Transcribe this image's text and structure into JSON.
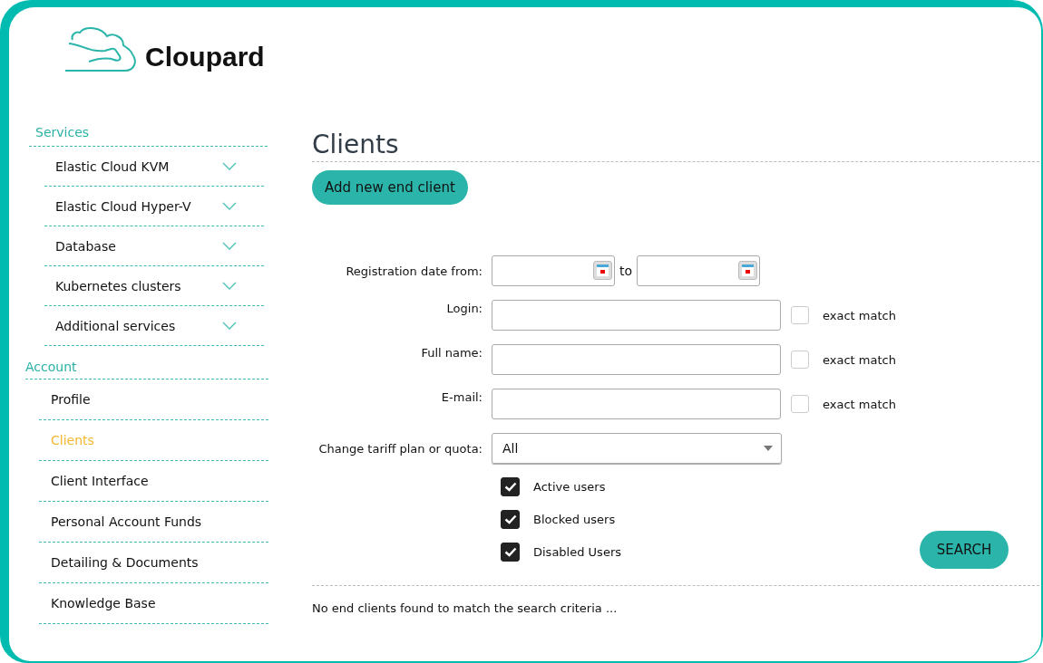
{
  "logo": {
    "text": "Cloupard"
  },
  "sidebar": {
    "sections": [
      {
        "title": "Services",
        "items": [
          {
            "label": "Elastic Cloud KVM",
            "kind": "dropdown",
            "selected": false
          },
          {
            "label": "Elastic Cloud Hyper-V",
            "kind": "dropdown",
            "selected": false
          },
          {
            "label": "Database",
            "kind": "dropdown",
            "selected": false
          },
          {
            "label": "Kubernetes clusters",
            "kind": "dropdown",
            "selected": false
          },
          {
            "label": "Additional services",
            "kind": "dropdown",
            "selected": false
          }
        ]
      },
      {
        "title": "Account",
        "items": [
          {
            "label": "Profile",
            "kind": "link",
            "selected": false
          },
          {
            "label": "Clients",
            "kind": "link",
            "selected": true
          },
          {
            "label": "Client Interface",
            "kind": "link",
            "selected": false
          },
          {
            "label": "Personal Account Funds",
            "kind": "link",
            "selected": false
          },
          {
            "label": "Detailing & Documents",
            "kind": "link",
            "selected": false
          },
          {
            "label": "Knowledge Base",
            "kind": "link",
            "selected": false
          }
        ]
      }
    ]
  },
  "page": {
    "title": "Clients",
    "add_button": "Add new end client"
  },
  "form": {
    "date": {
      "label": "Registration date from:",
      "separator": "to"
    },
    "text_fields": [
      {
        "label": "Login:",
        "exact_match": {
          "label": "exact match",
          "checked": false
        }
      },
      {
        "label": "Full name:",
        "exact_match": {
          "label": "exact match",
          "checked": false
        }
      },
      {
        "label": "E-mail:",
        "exact_match": {
          "label": "exact match",
          "checked": false
        }
      }
    ],
    "tariff": {
      "label": "Change tariff plan or quota:",
      "value": "All"
    },
    "checkboxes": [
      {
        "label": "Active users",
        "checked": true
      },
      {
        "label": "Blocked users",
        "checked": true
      },
      {
        "label": "Disabled Users",
        "checked": true
      }
    ],
    "search_button": "SEARCH"
  },
  "result_message": "No end clients found to match the search criteria ..."
}
